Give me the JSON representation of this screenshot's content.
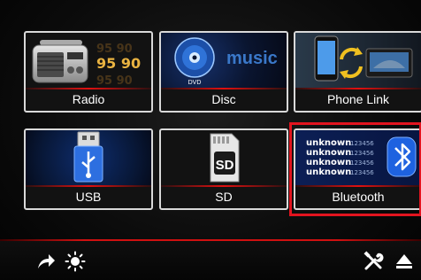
{
  "tiles": {
    "radio": {
      "label": "Radio",
      "freq": [
        "95 90",
        "95 90",
        "95 90"
      ]
    },
    "disc": {
      "label": "Disc",
      "word": "music",
      "disc_logo": "DVD"
    },
    "phone_link": {
      "label": "Phone Link"
    },
    "usb": {
      "label": "USB"
    },
    "sd": {
      "label": "SD",
      "card_text": "SD"
    },
    "bluetooth": {
      "label": "Bluetooth",
      "entries": [
        {
          "name": "unknown",
          "num": "123456"
        },
        {
          "name": "unknown",
          "num": "123456"
        },
        {
          "name": "unknown",
          "num": "123456"
        },
        {
          "name": "unknown",
          "num": "123456"
        }
      ]
    }
  },
  "selected_tile": "bluetooth",
  "bottom_bar": {
    "left_icons": [
      "share-arrow-icon",
      "brightness-icon"
    ],
    "right_icons": [
      "settings-tools-icon",
      "eject-icon"
    ]
  },
  "colors": {
    "accent": "#e2141f",
    "tile_border": "#d9d9d9",
    "text": "#ffffff"
  }
}
